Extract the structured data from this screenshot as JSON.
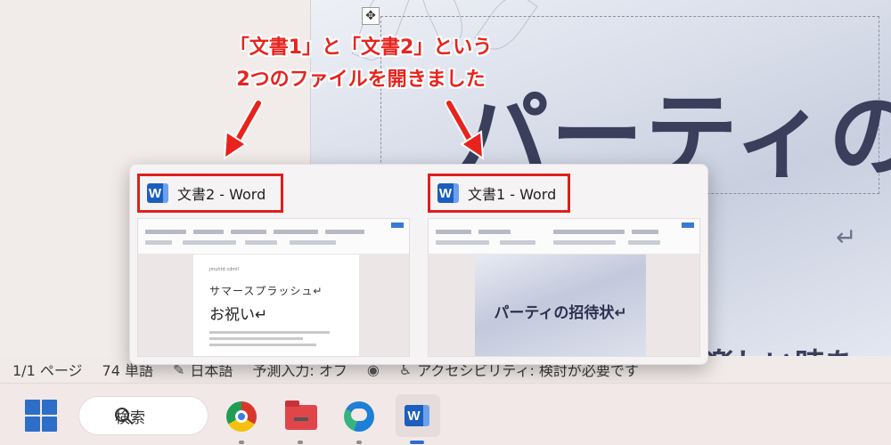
{
  "document": {
    "title": "パーティの",
    "return_mark": "↵",
    "subtext": "楽しい時を"
  },
  "statusbar": {
    "page": "1/1 ページ",
    "words": "74 単語",
    "language": "日本語",
    "predict": "予測入力: オフ",
    "accessibility": "アクセシビリティ: 検討が必要です"
  },
  "annotation": {
    "line1": "「文書1」と「文書2」という",
    "line2": "2つのファイルを開きました",
    "color": "#e8231d"
  },
  "previews": [
    {
      "title": "文書2 - Word",
      "content_small": "jmuhtd cdmll",
      "content_line1": "サマースプラッシュ↵",
      "content_line2": "お祝い↵"
    },
    {
      "title": "文書1 - Word",
      "content_title": "パーティの招待状↵"
    }
  ],
  "taskbar": {
    "search_label": "検索",
    "apps": [
      "chrome-icon",
      "file-explorer-icon",
      "edge-icon",
      "word-icon"
    ],
    "word_icon_letter": "W"
  },
  "colors": {
    "highlight_border": "#e01e1e",
    "word_blue": "#1b5ebe",
    "start_blue": "#2d6fc7"
  }
}
